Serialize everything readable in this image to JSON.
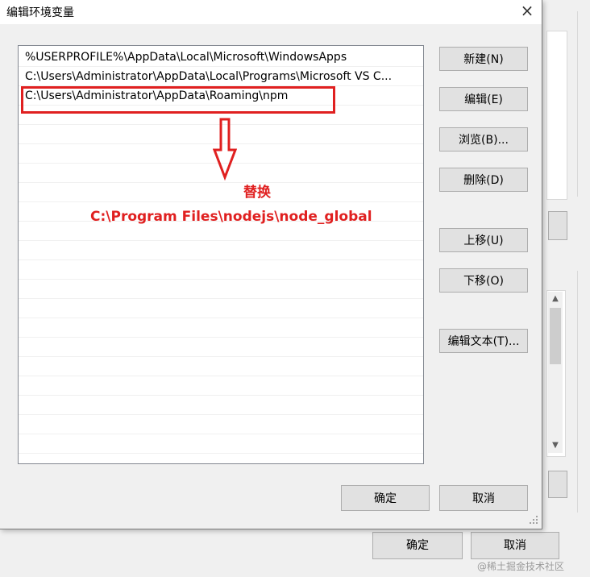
{
  "dialog": {
    "title": "编辑环境变量",
    "close_icon": "×"
  },
  "entries": [
    "%USERPROFILE%\\AppData\\Local\\Microsoft\\WindowsApps",
    "C:\\Users\\Administrator\\AppData\\Local\\Programs\\Microsoft VS C...",
    "C:\\Users\\Administrator\\AppData\\Roaming\\npm"
  ],
  "annotation": {
    "replace_label": "替换",
    "new_path": "C:\\Program Files\\nodejs\\node_global",
    "color": "#e02020"
  },
  "buttons": {
    "new": "新建(N)",
    "edit": "编辑(E)",
    "browse": "浏览(B)...",
    "delete": "删除(D)",
    "move_up": "上移(U)",
    "move_down": "下移(O)",
    "edit_text": "编辑文本(T)...",
    "ok": "确定",
    "cancel": "取消"
  },
  "parent_dialog": {
    "ok": "确定",
    "cancel": "取消",
    "scroll_up_icon": "▲",
    "scroll_down_icon": "▼"
  },
  "watermark": "@稀土掘金技术社区"
}
